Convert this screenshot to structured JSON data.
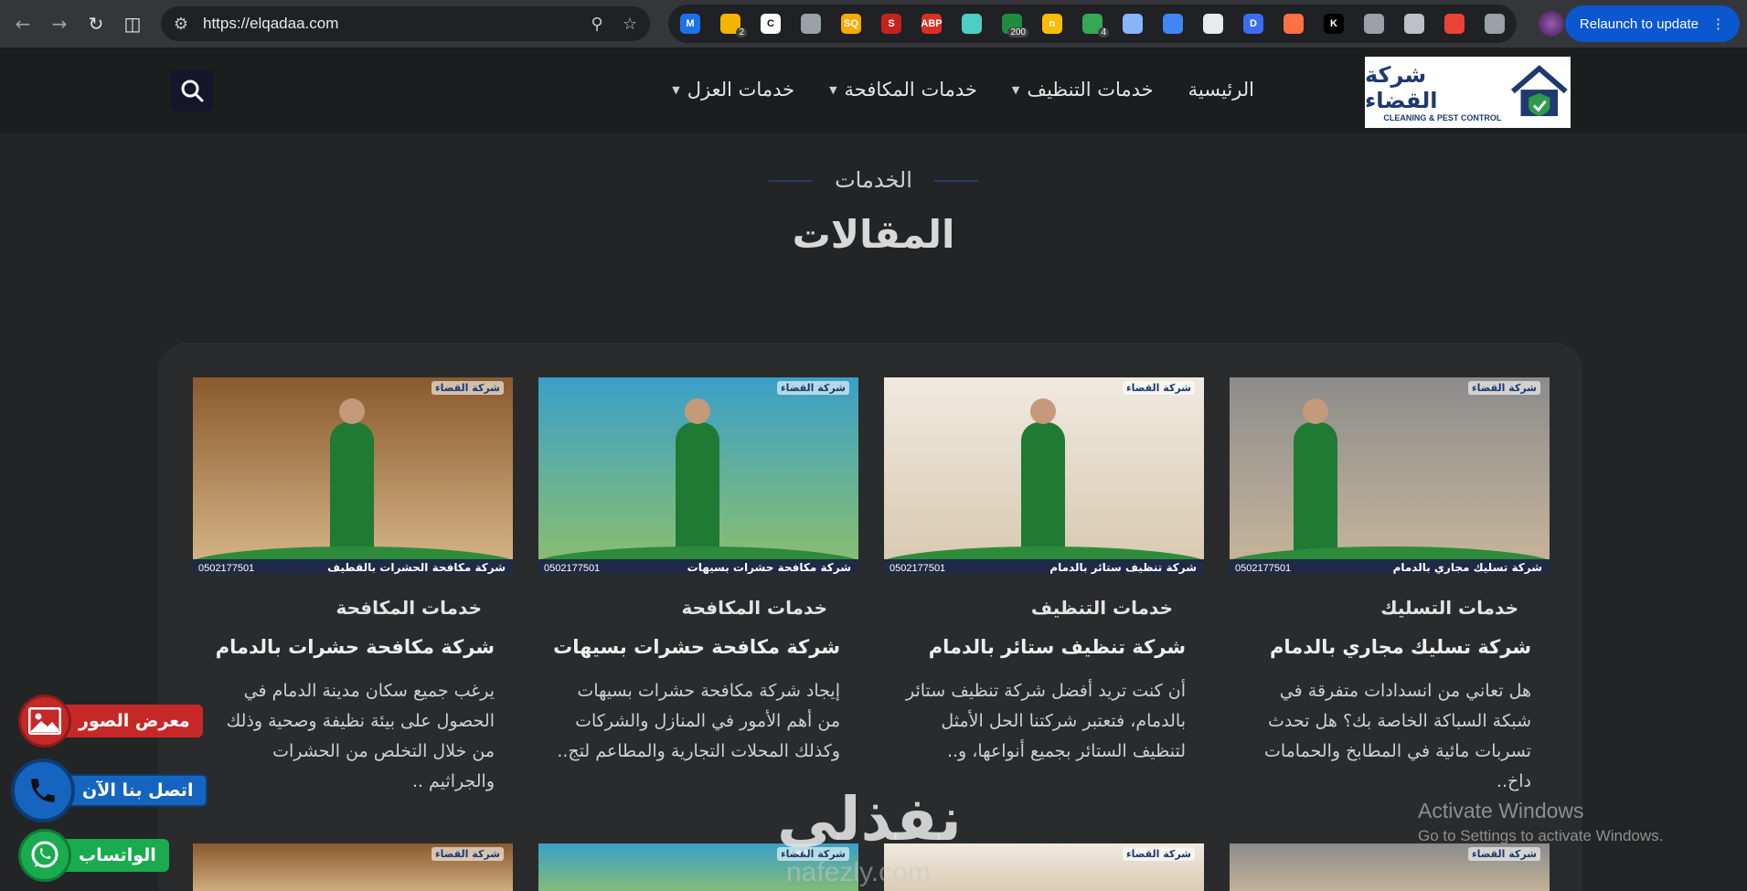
{
  "browser": {
    "url": "https://elqadaa.com",
    "relaunch_label": "Relaunch to update",
    "extensions": [
      {
        "name": "m-extension-icon",
        "letter": "M",
        "color": "#1a73e8",
        "badge": ""
      },
      {
        "name": "bulb-extension-icon",
        "letter": "",
        "color": "#f4b400",
        "badge": "2"
      },
      {
        "name": "c-extension-icon",
        "letter": "C",
        "color": "#ffffff",
        "badge": ""
      },
      {
        "name": "camera-extension-icon",
        "letter": "",
        "color": "#9aa0a6",
        "badge": ""
      },
      {
        "name": "sq-extension-icon",
        "letter": "SQ",
        "color": "#f9ab00",
        "badge": ""
      },
      {
        "name": "s-extension-icon",
        "letter": "S",
        "color": "#c5221f",
        "badge": ""
      },
      {
        "name": "abp-extension-icon",
        "letter": "ABP",
        "color": "#d93025",
        "badge": ""
      },
      {
        "name": "image-extension-icon",
        "letter": "",
        "color": "#4ecdc4",
        "badge": ""
      },
      {
        "name": "counter-extension-icon",
        "letter": "",
        "color": "#1e8e3e",
        "badge": "200"
      },
      {
        "name": "n-extension-icon",
        "letter": "n",
        "color": "#fbbc04",
        "badge": ""
      },
      {
        "name": "chart-extension-icon",
        "letter": "",
        "color": "#34a853",
        "badge": "4"
      },
      {
        "name": "doc-extension-icon",
        "letter": "",
        "color": "#8ab4f8",
        "badge": ""
      },
      {
        "name": "arrows-extension-icon",
        "letter": "",
        "color": "#4285f4",
        "badge": ""
      },
      {
        "name": "panda-extension-icon",
        "letter": "",
        "color": "#e8eaed",
        "badge": ""
      },
      {
        "name": "d-extension-icon",
        "letter": "D",
        "color": "#3c6df0",
        "badge": ""
      },
      {
        "name": "sun-extension-icon",
        "letter": "",
        "color": "#ff7043",
        "badge": ""
      },
      {
        "name": "k-extension-icon",
        "letter": "K",
        "color": "#000000",
        "badge": ""
      },
      {
        "name": "shield-extension-icon",
        "letter": "",
        "color": "#9aa0a6",
        "badge": ""
      },
      {
        "name": "window-extension-icon",
        "letter": "",
        "color": "#bdc1c6",
        "badge": ""
      },
      {
        "name": "glasses-extension-icon",
        "letter": "",
        "color": "#ea4335",
        "badge": ""
      },
      {
        "name": "puzzle-extension-icon",
        "letter": "",
        "color": "#9aa0a6",
        "badge": ""
      }
    ]
  },
  "site": {
    "logo_text": "شركة القضاء",
    "logo_subtext": "CLEANING & PEST CONTROL",
    "nav": [
      {
        "label": "الرئيسية",
        "dropdown": false
      },
      {
        "label": "خدمات التنظيف",
        "dropdown": true
      },
      {
        "label": "خدمات المكافحة",
        "dropdown": true
      },
      {
        "label": "خدمات العزل",
        "dropdown": true
      }
    ],
    "section_label": "الخدمات",
    "section_title": "المقالات"
  },
  "cards": [
    {
      "image_caption": "شركة تسليك مجاري بالدمام",
      "image_phone": "0502177501",
      "image_brand": "شركة القضاء",
      "category": "خدمات التسليك",
      "title": "شركة تسليك مجاري بالدمام",
      "excerpt": "هل تعاني من انسدادات متفرقة في شبكة السباكة الخاصة بك؟ هل تحدث تسربات مائية في المطابخ والحمامات داخ..",
      "colors": [
        "#c9b79a",
        "#8c8c8c"
      ]
    },
    {
      "image_caption": "شركة تنظيف ستائر بالدمام",
      "image_phone": "0502177501",
      "image_brand": "شركة القضاء",
      "category": "خدمات التنظيف",
      "title": "شركة تنظيف ستائر بالدمام",
      "excerpt": "أن كنت تريد أفضل شركة تنظيف ستائر بالدمام، فتعتبر شركتنا الحل الأمثل لتنظيف الستائر بجميع أنواعها، و..",
      "colors": [
        "#d8c8ae",
        "#efe9df"
      ]
    },
    {
      "image_caption": "شركة مكافحة حشرات بسيهات",
      "image_phone": "0502177501",
      "image_brand": "شركة القضاء",
      "category": "خدمات المكافحة",
      "title": "شركة مكافحة حشرات بسيهات",
      "excerpt": "إيجاد شركة مكافحة حشرات بسيهات من أهم الأمور في المنازل والشركات وكذلك المحلات التجارية والمطاعم لتج..",
      "colors": [
        "#8fc06b",
        "#3aa0c8"
      ]
    },
    {
      "image_caption": "شركة مكافحة الحشرات بالقطيف",
      "image_phone": "0502177501",
      "image_brand": "شركة القضاء",
      "category": "خدمات المكافحة",
      "title": "شركة مكافحة حشرات بالدمام",
      "excerpt": "يرغب جميع سكان مدينة الدمام في الحصول على بيئة نظيفة وصحية وذلك من خلال التخلص من الحشرات والجراثيم ..",
      "colors": [
        "#d9b98a",
        "#8a5a2e"
      ]
    }
  ],
  "row2_brand": "شركة القضاء",
  "floating": {
    "gallery_label": "معرض الصور",
    "call_label": "اتصل بنا الآن",
    "whatsapp_label": "الواتساب"
  },
  "windows_watermark": {
    "line1": "Activate Windows",
    "line2": "Go to Settings to activate Windows."
  },
  "site_watermark": {
    "arabic": "نفذلي",
    "latin": "nafezly.com"
  }
}
